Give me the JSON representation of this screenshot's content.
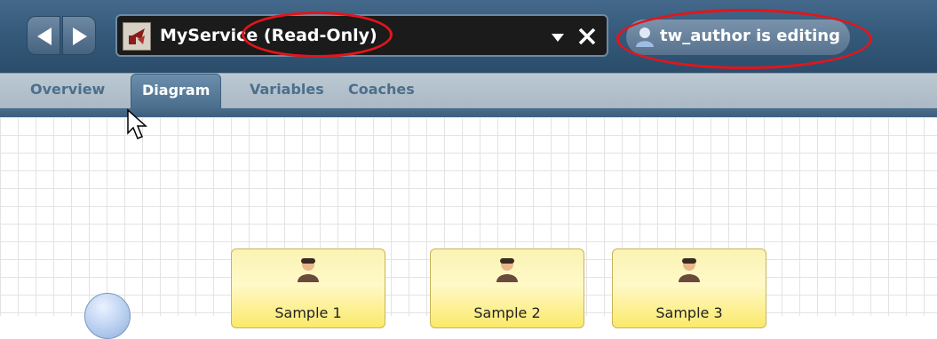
{
  "toolbar": {
    "back_icon": "left-arrow-icon",
    "forward_icon": "right-arrow-icon",
    "service_name": "MyService",
    "readonly_label": "(Read-Only)",
    "dropdown_icon": "caret-down-icon",
    "close_icon": "close-icon",
    "editing_status": "tw_author is editing",
    "highlight_color": "#e3151b"
  },
  "tabs": [
    {
      "label": "Overview",
      "active": false
    },
    {
      "label": "Diagram",
      "active": true
    },
    {
      "label": "Variables",
      "active": false
    },
    {
      "label": "Coaches",
      "active": false
    }
  ],
  "diagram": {
    "tasks": [
      {
        "label": "Sample 1"
      },
      {
        "label": "Sample 2"
      },
      {
        "label": "Sample 3"
      }
    ]
  }
}
